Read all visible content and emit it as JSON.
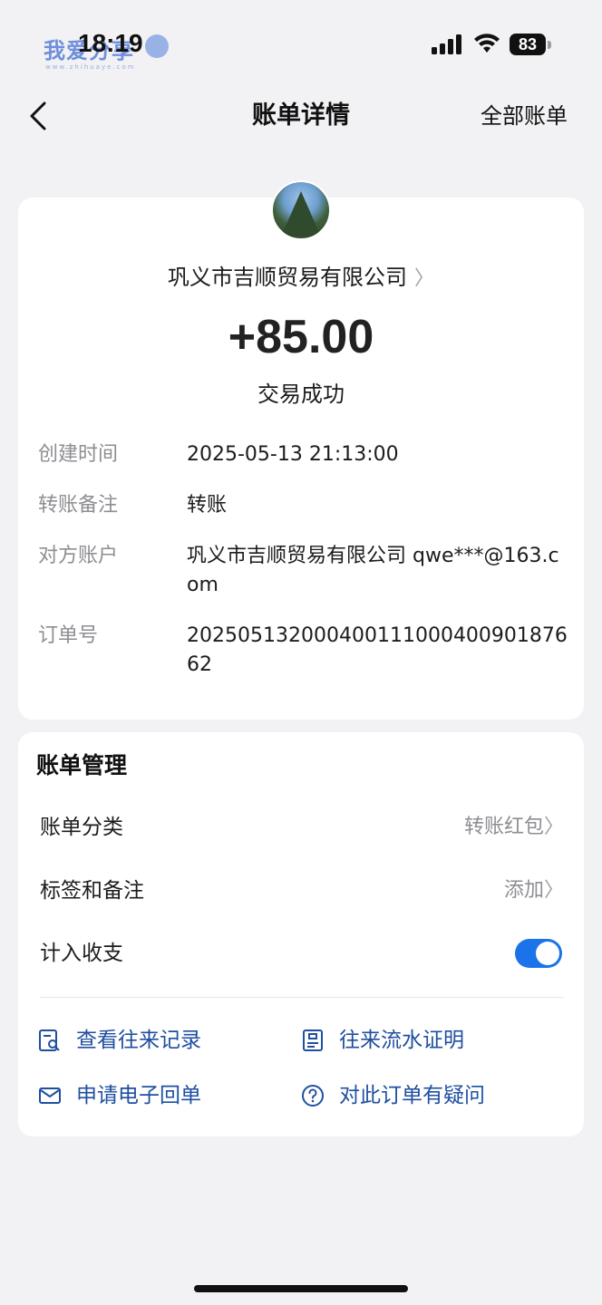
{
  "status_bar": {
    "time": "18:19",
    "battery": "83",
    "watermark": "我爱分享",
    "watermark_sub": "www.zhihuaye.com"
  },
  "nav": {
    "title": "账单详情",
    "right_action": "全部账单"
  },
  "detail": {
    "payee": "巩义市吉顺贸易有限公司",
    "amount": "+85.00",
    "status": "交易成功",
    "rows": [
      {
        "label": "创建时间",
        "value": "2025-05-13 21:13:00"
      },
      {
        "label": "转账备注",
        "value": "转账"
      },
      {
        "label": "对方账户",
        "value": "巩义市吉顺贸易有限公司 qwe***@163.com"
      },
      {
        "label": "订单号",
        "value": "20250513200040011100040090187662"
      }
    ]
  },
  "manage": {
    "title": "账单管理",
    "rows": [
      {
        "label": "账单分类",
        "value": "转账红包"
      },
      {
        "label": "标签和备注",
        "value": "添加"
      },
      {
        "label": "计入收支",
        "value": ""
      }
    ],
    "toggle_on": true,
    "actions": [
      {
        "label": "查看往来记录",
        "icon": "search-record-icon"
      },
      {
        "label": "往来流水证明",
        "icon": "document-icon"
      },
      {
        "label": "申请电子回单",
        "icon": "mail-icon"
      },
      {
        "label": "对此订单有疑问",
        "icon": "question-icon"
      }
    ]
  },
  "colors": {
    "accent": "#1a73e8",
    "action_text": "#1f4fa0",
    "background": "#f2f2f4"
  }
}
